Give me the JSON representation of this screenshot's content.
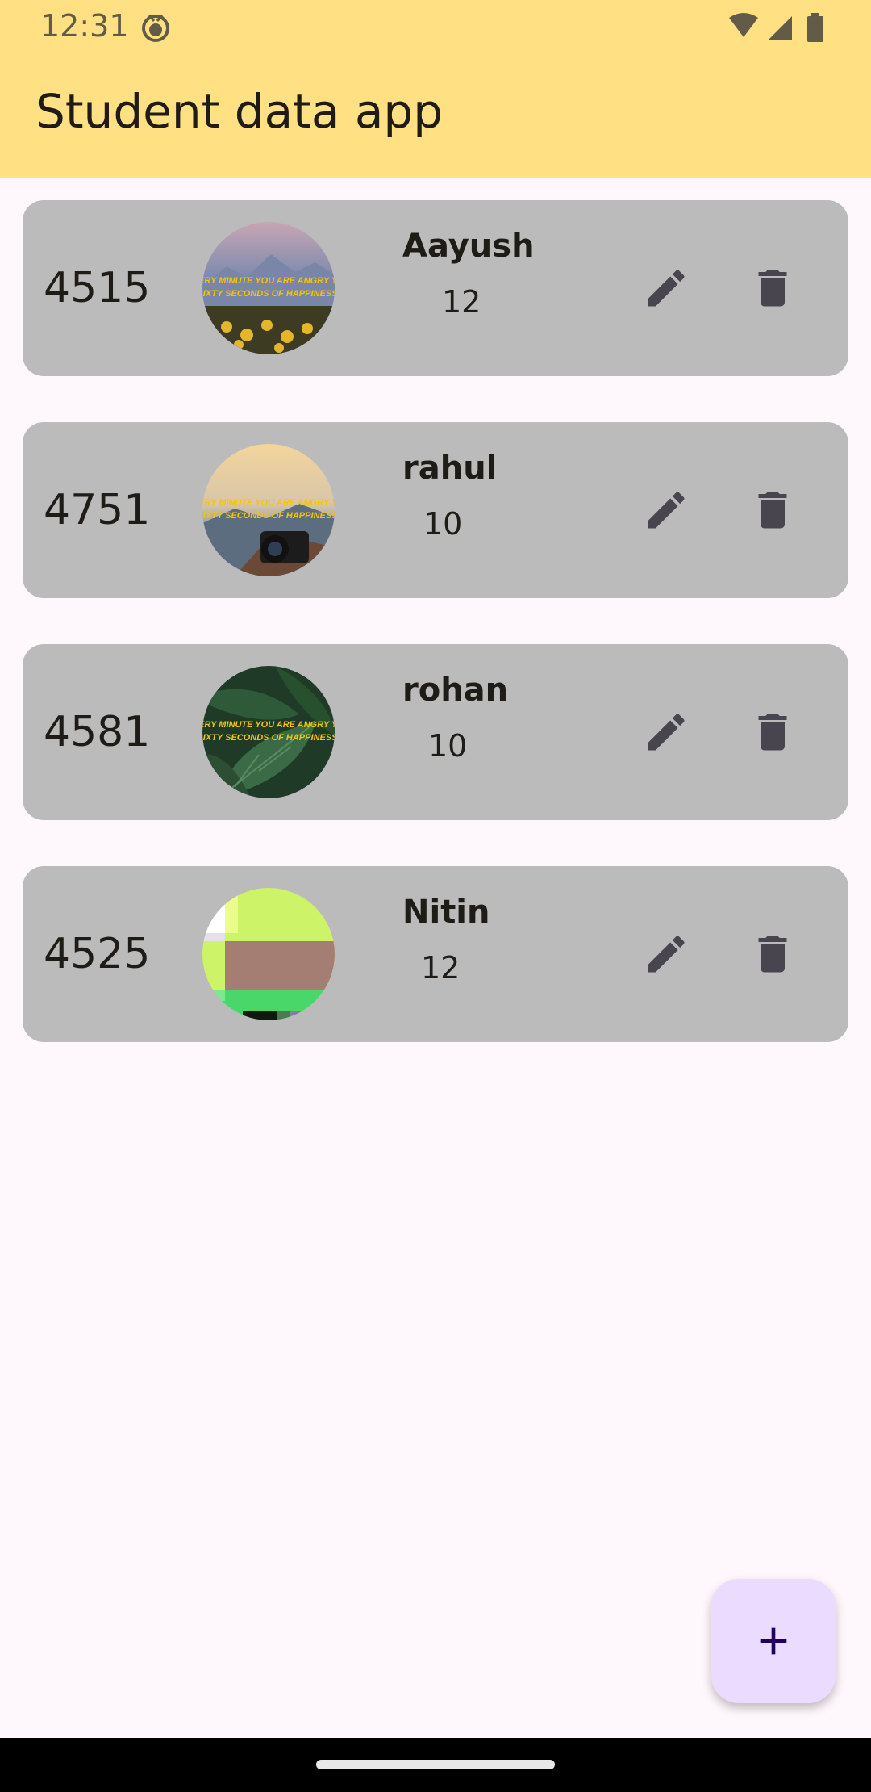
{
  "status_bar": {
    "time": "12:31",
    "icons": [
      "face-icon",
      "wifi-icon",
      "signal-icon",
      "battery-icon"
    ]
  },
  "app_bar": {
    "title": "Student data app",
    "background": "#ffe083"
  },
  "students": [
    {
      "id": "4515",
      "name": "Aayush",
      "class": "12",
      "avatar": "mountain-flowers-quote-photo"
    },
    {
      "id": "4751",
      "name": "rahul",
      "class": "10",
      "avatar": "camera-sunset-quote-photo"
    },
    {
      "id": "4581",
      "name": "rohan",
      "class": "10",
      "avatar": "green-leaves-quote-photo"
    },
    {
      "id": "4525",
      "name": "Nitin",
      "class": "12",
      "avatar": "pixelated-photo"
    }
  ],
  "avatar_caption": {
    "line1": "EVERY MINUTE YOU ARE ANGRY YOU",
    "line2": "SIXTY SECONDS OF HAPPINESS."
  },
  "actions": {
    "edit_icon": "pencil-icon",
    "delete_icon": "trash-icon"
  },
  "fab": {
    "icon": "plus-icon",
    "background": "#ebdcff"
  },
  "colors": {
    "card": "#bbbbbb",
    "icon": "#49454f",
    "caption": "#f6c400"
  }
}
